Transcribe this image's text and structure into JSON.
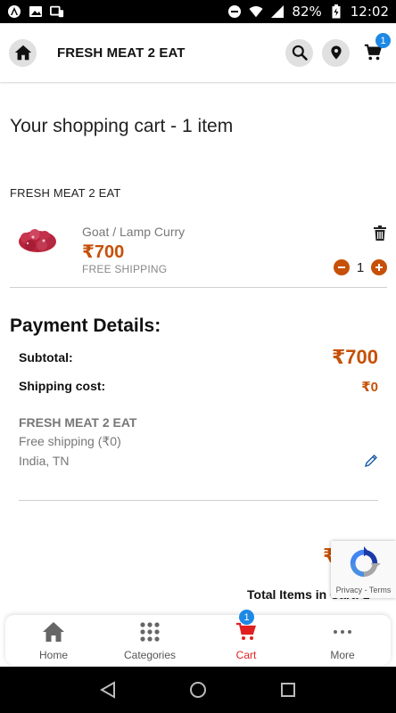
{
  "status_bar": {
    "battery_percent": "82%",
    "time": "12:02"
  },
  "header": {
    "title": "FRESH MEAT 2 EAT",
    "cart_count": "1"
  },
  "main": {
    "page_title": "Your shopping cart - 1 item",
    "store_name": "FRESH MEAT 2 EAT",
    "items": [
      {
        "name": "Goat / Lamp Curry",
        "price": "₹700",
        "shipping": "FREE SHIPPING",
        "quantity": "1"
      }
    ]
  },
  "payment": {
    "title": "Payment Details:",
    "subtotal_label": "Subtotal:",
    "subtotal_value": "₹700",
    "shipping_label": "Shipping cost:",
    "shipping_value": "₹0",
    "address": {
      "store": "FRESH MEAT 2 EAT",
      "method": "Free shipping (₹0)",
      "location": "India, TN"
    },
    "total_partial": "₹",
    "total_items_label": "Total Items in Cart: 1"
  },
  "recaptcha": {
    "links": "Privacy - Terms"
  },
  "tabs": [
    {
      "label": "Home",
      "icon": "home-icon"
    },
    {
      "label": "Categories",
      "icon": "grid-icon"
    },
    {
      "label": "Cart",
      "icon": "cart-icon",
      "badge": "1",
      "active": true
    },
    {
      "label": "More",
      "icon": "more-icon"
    }
  ],
  "colors": {
    "accent": "#c65007",
    "active_tab": "#e02020",
    "badge": "#1e88e5"
  }
}
